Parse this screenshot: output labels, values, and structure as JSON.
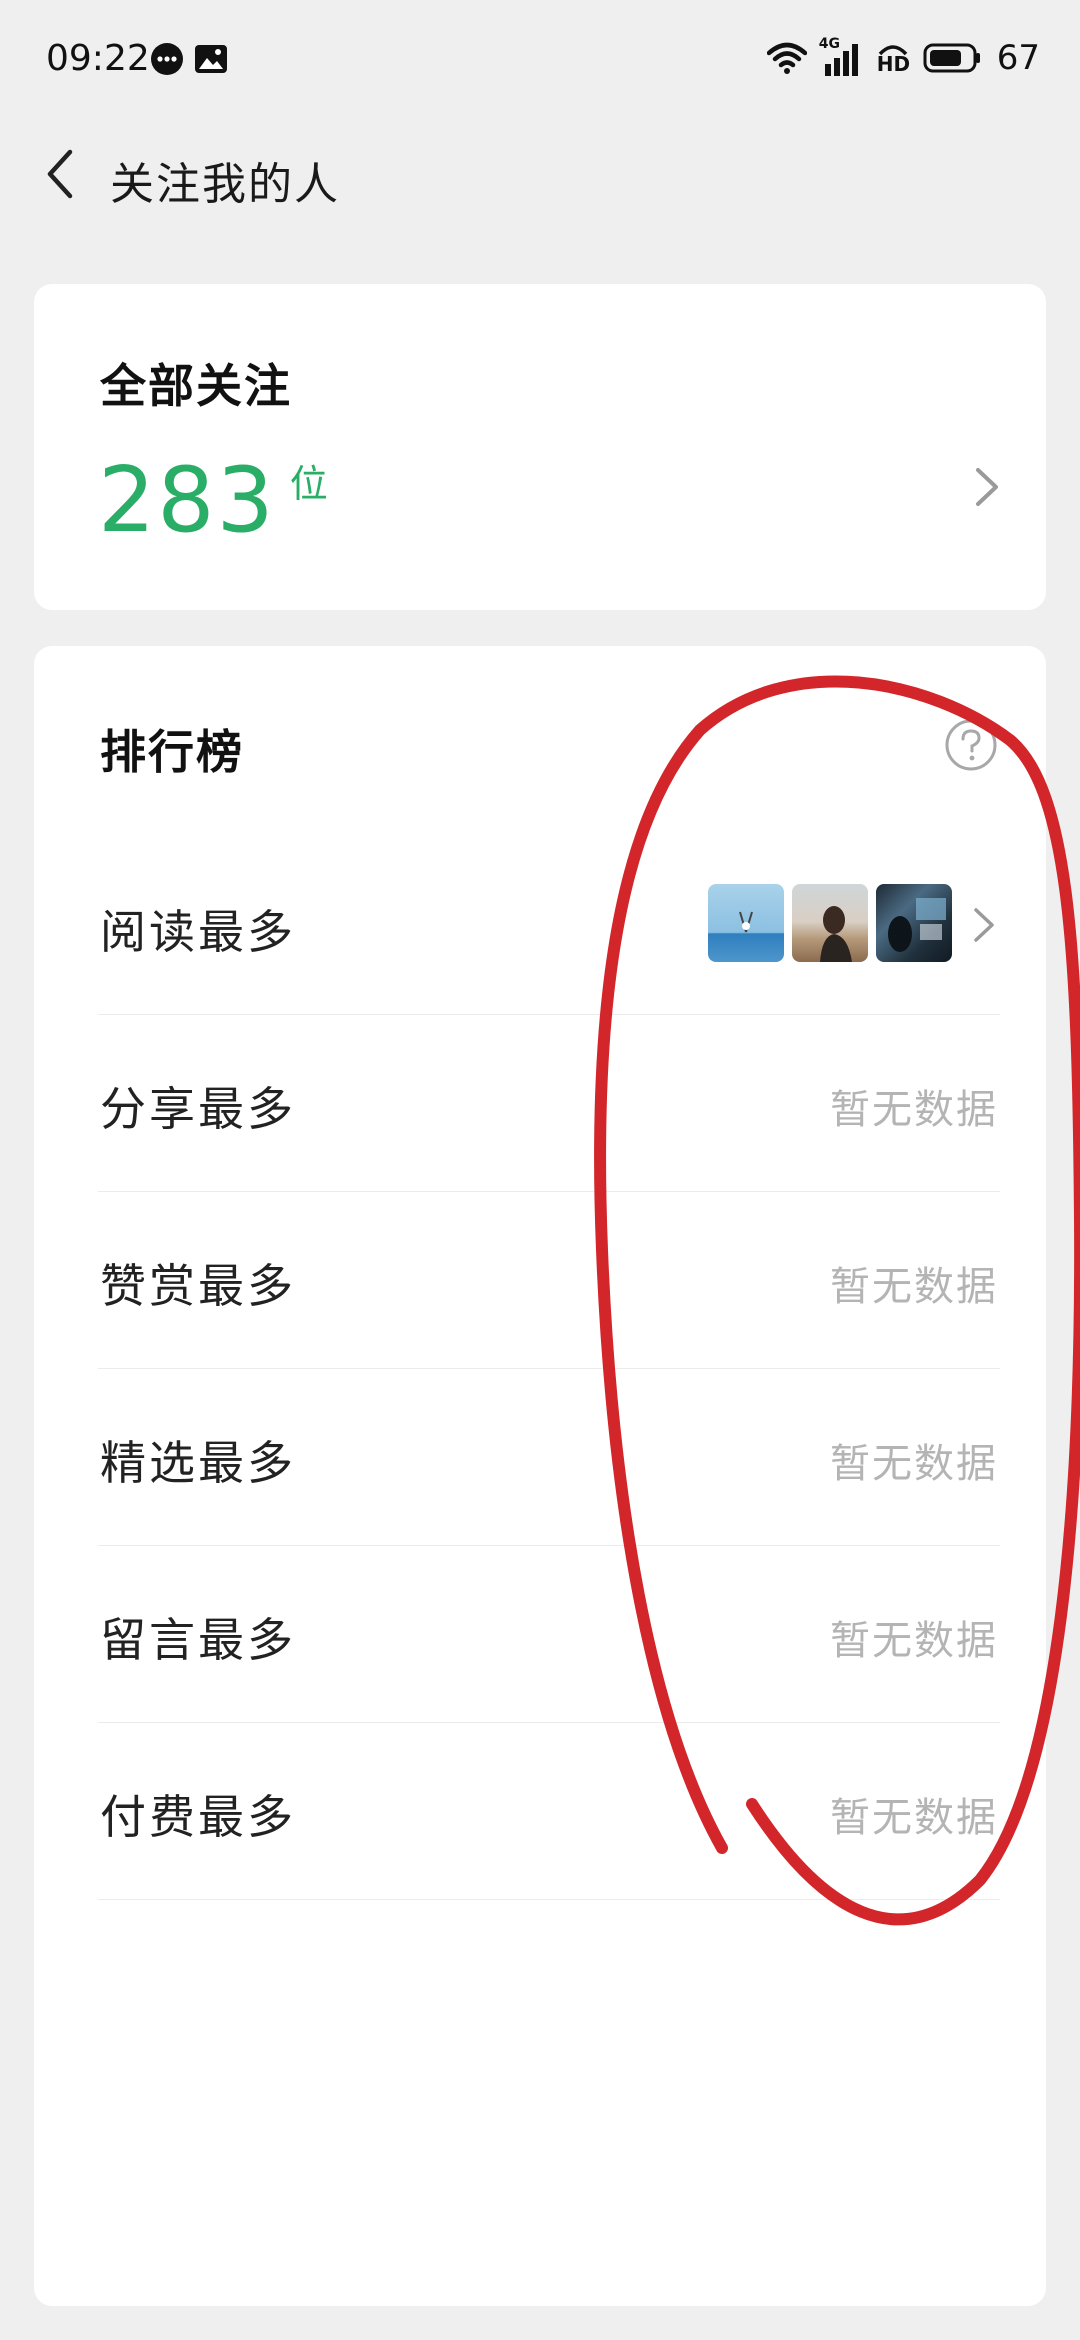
{
  "status_bar": {
    "time": "09:22",
    "network_label": "4G",
    "hd_label": "HD",
    "battery_level": "67"
  },
  "header": {
    "title": "关注我的人"
  },
  "summary": {
    "label": "全部关注",
    "count": "283",
    "unit": "位"
  },
  "ranking": {
    "title": "排行榜",
    "rows": [
      {
        "label": "阅读最多",
        "empty_text": ""
      },
      {
        "label": "分享最多",
        "empty_text": "暂无数据"
      },
      {
        "label": "赞赏最多",
        "empty_text": "暂无数据"
      },
      {
        "label": "精选最多",
        "empty_text": "暂无数据"
      },
      {
        "label": "留言最多",
        "empty_text": "暂无数据"
      },
      {
        "label": "付费最多",
        "empty_text": "暂无数据"
      }
    ]
  },
  "colors": {
    "accent_green": "#2aae67",
    "annotation_red": "#d3262b",
    "muted_text": "#b4b4b4"
  },
  "icons": {
    "back": "chevron-left-icon",
    "chevron": "chevron-right-icon",
    "help": "question-circle-icon",
    "wifi": "wifi-icon",
    "signal": "signal-icon",
    "battery": "battery-icon",
    "message": "message-bubble-icon",
    "gallery": "image-icon"
  }
}
